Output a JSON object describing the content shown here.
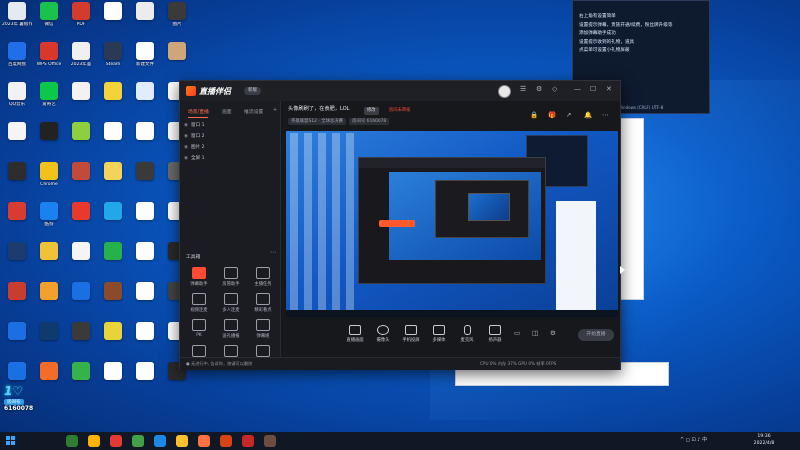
{
  "desktop_icons": [
    {
      "label": "2023年 暑假作业",
      "color": "#e4e9f2"
    },
    {
      "label": "微信",
      "color": "#18c24c"
    },
    {
      "label": "PDF",
      "color": "#d33b2c"
    },
    {
      "label": "",
      "color": "#ffffff"
    },
    {
      "label": "",
      "color": "#ececec"
    },
    {
      "label": "图片",
      "color": "#3a3a3a"
    },
    {
      "label": "百度网盘",
      "color": "#1f6fe8"
    },
    {
      "label": "WPS Office",
      "color": "#d8382b"
    },
    {
      "label": "2023年鉴",
      "color": "#f0f0f0"
    },
    {
      "label": "Steam",
      "color": "#2a3a55"
    },
    {
      "label": "新建文件",
      "color": "#ffffff"
    },
    {
      "label": "",
      "color": "#cfa67a"
    },
    {
      "label": "QQ音乐",
      "color": "#f2f2f2"
    },
    {
      "label": "爱奇艺",
      "color": "#0bc84b"
    },
    {
      "label": "",
      "color": "#f2f2f2"
    },
    {
      "label": "",
      "color": "#f4d23a"
    },
    {
      "label": "",
      "color": "#e0ecff"
    },
    {
      "label": "",
      "color": "#ffffff"
    },
    {
      "label": "",
      "color": "#f5f5f5"
    },
    {
      "label": "",
      "color": "#222222"
    },
    {
      "label": "",
      "color": "#8ecf3f"
    },
    {
      "label": "",
      "color": "#ffffff"
    },
    {
      "label": "",
      "color": "#ffffff"
    },
    {
      "label": "",
      "color": "#ffffff"
    },
    {
      "label": "",
      "color": "#2d2d2d"
    },
    {
      "label": "Chrome",
      "color": "#f2c21b"
    },
    {
      "label": "",
      "color": "#c24a3a"
    },
    {
      "label": "",
      "color": "#f3d35a"
    },
    {
      "label": "",
      "color": "#3a3a3a"
    },
    {
      "label": "",
      "color": "#6a6a6a"
    },
    {
      "label": "",
      "color": "#d83b2f"
    },
    {
      "label": "酷狗",
      "color": "#1a82f0"
    },
    {
      "label": "",
      "color": "#e8392c"
    },
    {
      "label": "",
      "color": "#22a8ea"
    },
    {
      "label": "",
      "color": "#ffffff"
    },
    {
      "label": "",
      "color": "#ffffff"
    },
    {
      "label": "",
      "color": "#1c3c70"
    },
    {
      "label": "",
      "color": "#f0c23a"
    },
    {
      "label": "",
      "color": "#f5f5f5"
    },
    {
      "label": "",
      "color": "#26b24a"
    },
    {
      "label": "",
      "color": "#ffffff"
    },
    {
      "label": "",
      "color": "#2a2a2a"
    },
    {
      "label": "",
      "color": "#c83d2f"
    },
    {
      "label": "",
      "color": "#f2a12f"
    },
    {
      "label": "",
      "color": "#1a6fe3"
    },
    {
      "label": "",
      "color": "#8b4a2a"
    },
    {
      "label": "",
      "color": "#ffffff"
    },
    {
      "label": "",
      "color": "#444444"
    },
    {
      "label": "",
      "color": "#1a6fe3"
    },
    {
      "label": "",
      "color": "#0d3b6e"
    },
    {
      "label": "",
      "color": "#3a3a3a"
    },
    {
      "label": "",
      "color": "#e8d33a"
    },
    {
      "label": "",
      "color": "#ffffff"
    },
    {
      "label": "",
      "color": "#ffffff"
    },
    {
      "label": "",
      "color": "#1a6fe3"
    },
    {
      "label": "",
      "color": "#f26d2a"
    },
    {
      "label": "",
      "color": "#36b24a"
    },
    {
      "label": "",
      "color": "#ffffff"
    },
    {
      "label": "",
      "color": "#ffffff"
    },
    {
      "label": "",
      "color": "#2a2a2a"
    }
  ],
  "notepad": {
    "lines": [
      "右上角有设置简单",
      "设置提示弹幕，贵族开通/续费，粉丝牌升级等",
      "添加弹幕助手成功",
      "设置提示收到的礼物，道具",
      "点菜单可设置小礼物屏蔽"
    ],
    "status": "第1行，第1列    100%    Windows (CRLF)    UTF-8"
  },
  "app": {
    "logo_text": "直播伴侣",
    "version_badge": "新版",
    "left_tabs": [
      "场景/直播",
      "画面",
      "推流设置"
    ],
    "scenes": [
      {
        "name": "窗口 1"
      },
      {
        "name": "窗口 2"
      },
      {
        "name": "图片 2"
      },
      {
        "name": "全屏 1"
      }
    ],
    "add_scene": "+",
    "tools_title": "工具箱",
    "tools": [
      {
        "label": "弹幕助手",
        "hl": true
      },
      {
        "label": "房管助手",
        "hl": false
      },
      {
        "label": "主播任务",
        "hl": false
      },
      {
        "label": "视频连麦",
        "hl": false
      },
      {
        "label": "多人连麦",
        "hl": false
      },
      {
        "label": "精彩看点",
        "hl": false
      },
      {
        "label": "PK",
        "hl": false
      },
      {
        "label": "送礼播报",
        "hl": false
      },
      {
        "label": "弹幕姬",
        "hl": false
      },
      {
        "label": "虚拟形象",
        "hl": false
      },
      {
        "label": "",
        "hl": false
      },
      {
        "label": "",
        "hl": false
      }
    ],
    "stream_title": "头像刷刷了，在食肥，LOL",
    "tag_edit": "修改",
    "tag_red": "房间未审核",
    "meta_chips": [
      "英雄联盟S12 · 全球总决赛",
      "房间号 6160078",
      "",
      ""
    ],
    "bottom_buttons": [
      "直播画面",
      "摄像头",
      "手机投屏",
      "多媒体",
      "麦克风",
      "扬声器"
    ],
    "start_live": "开始直播",
    "status_left": "● 无进行中, 告诉你，按键可以删除",
    "status_right": "CPU  0%   内存  37%   GPU  0%   帧率  0FPS"
  },
  "room_id": {
    "tag": "房间号",
    "number": "6160078"
  },
  "taskbar": {
    "apps": [
      "#2e7d32",
      "#ffb300",
      "#e53935",
      "#43a047",
      "#1e88e5",
      "#fbc02d",
      "#ff7043",
      "#d84315",
      "#c62828",
      "#6d4c41"
    ],
    "tray_text": "^  ◻  ⊡  ♪  中",
    "time": "19:36",
    "date": "2022/4/8"
  }
}
